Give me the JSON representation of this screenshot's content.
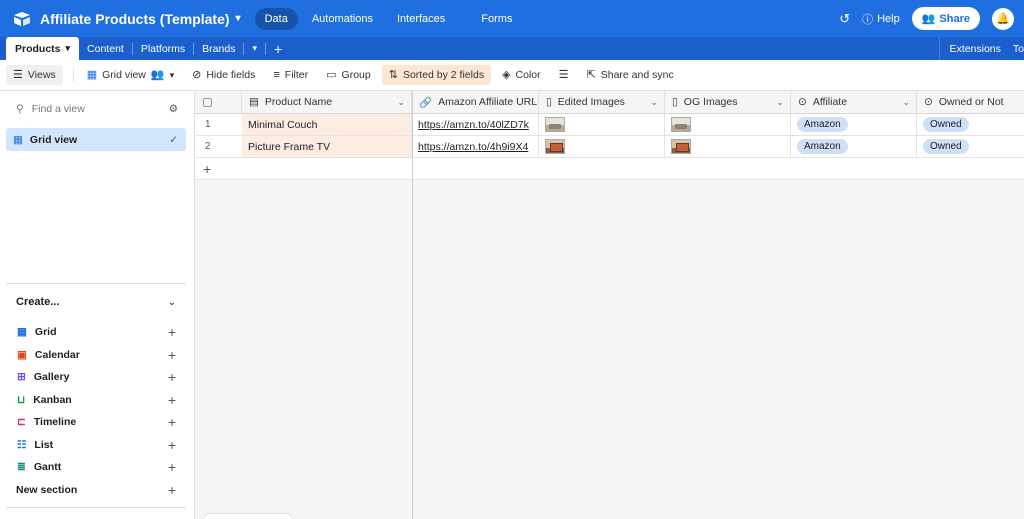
{
  "app": {
    "base_title": "Affiliate Products (Template)",
    "nav": [
      "Data",
      "Automations",
      "Interfaces",
      "Forms"
    ],
    "active_nav": "Data",
    "help_label": "Help",
    "share_label": "Share"
  },
  "tables": {
    "items": [
      "Products",
      "Content",
      "Platforms",
      "Brands"
    ],
    "active": "Products",
    "extensions_label": "Extensions",
    "tools_label": "To"
  },
  "toolbar": {
    "views_label": "Views",
    "view_name": "Grid view",
    "hide_fields": "Hide fields",
    "filter": "Filter",
    "group": "Group",
    "sorted": "Sorted by 2 fields",
    "color": "Color",
    "share_sync": "Share and sync"
  },
  "sidebar": {
    "find_placeholder": "Find a view",
    "views": [
      "Grid view"
    ],
    "create_label": "Create...",
    "create_items": [
      "Grid",
      "Calendar",
      "Gallery",
      "Kanban",
      "Timeline",
      "List",
      "Gantt",
      "New section"
    ]
  },
  "grid": {
    "columns": [
      "Product Name",
      "Amazon Affiliate URL",
      "Edited Images",
      "OG Images",
      "Affiliate",
      "Owned or Not"
    ],
    "rows": [
      {
        "num": "1",
        "name": "Minimal Couch",
        "url": "https://amzn.to/40lZD7k",
        "affiliate": "Amazon",
        "owned": "Owned"
      },
      {
        "num": "2",
        "name": "Picture Frame TV",
        "url": "https://amzn.to/4h9i9X4",
        "affiliate": "Amazon",
        "owned": "Owned"
      }
    ]
  },
  "colors": {
    "topbar": "#1f6fe0",
    "tabbar": "#1a5fcc",
    "sorted_bg": "#fde6d4",
    "primary_cell_bg": "#fdece1",
    "selected_view_bg": "#d1e6fb",
    "pill_bg": "#cfdff5"
  }
}
